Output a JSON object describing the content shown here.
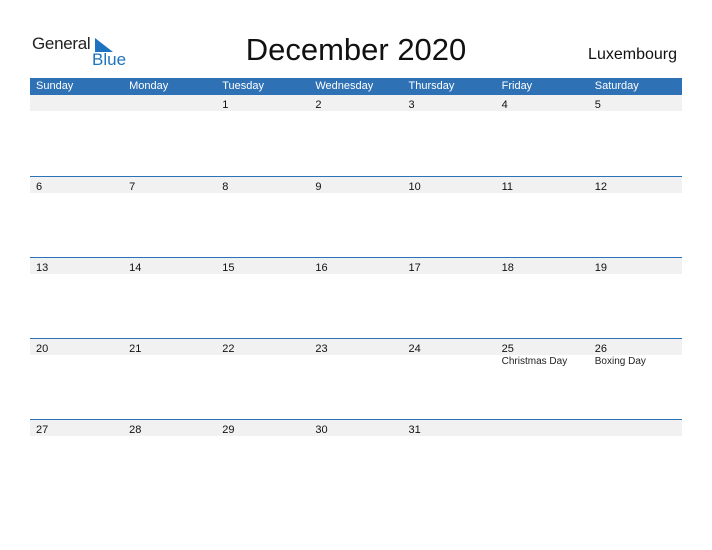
{
  "logo": {
    "word1": "General",
    "word2": "Blue"
  },
  "header": {
    "title": "December 2020",
    "country": "Luxembourg"
  },
  "colors": {
    "accent": "#2e71b5",
    "strip": "#f1f1f1"
  },
  "weekdays": [
    "Sunday",
    "Monday",
    "Tuesday",
    "Wednesday",
    "Thursday",
    "Friday",
    "Saturday"
  ],
  "weeks": [
    {
      "days": [
        "",
        "",
        "1",
        "2",
        "3",
        "4",
        "5"
      ],
      "events": [
        "",
        "",
        "",
        "",
        "",
        "",
        ""
      ]
    },
    {
      "days": [
        "6",
        "7",
        "8",
        "9",
        "10",
        "11",
        "12"
      ],
      "events": [
        "",
        "",
        "",
        "",
        "",
        "",
        ""
      ]
    },
    {
      "days": [
        "13",
        "14",
        "15",
        "16",
        "17",
        "18",
        "19"
      ],
      "events": [
        "",
        "",
        "",
        "",
        "",
        "",
        ""
      ]
    },
    {
      "days": [
        "20",
        "21",
        "22",
        "23",
        "24",
        "25",
        "26"
      ],
      "events": [
        "",
        "",
        "",
        "",
        "",
        "Christmas Day",
        "Boxing Day"
      ]
    },
    {
      "days": [
        "27",
        "28",
        "29",
        "30",
        "31",
        "",
        ""
      ],
      "events": [
        "",
        "",
        "",
        "",
        "",
        "",
        ""
      ]
    }
  ]
}
